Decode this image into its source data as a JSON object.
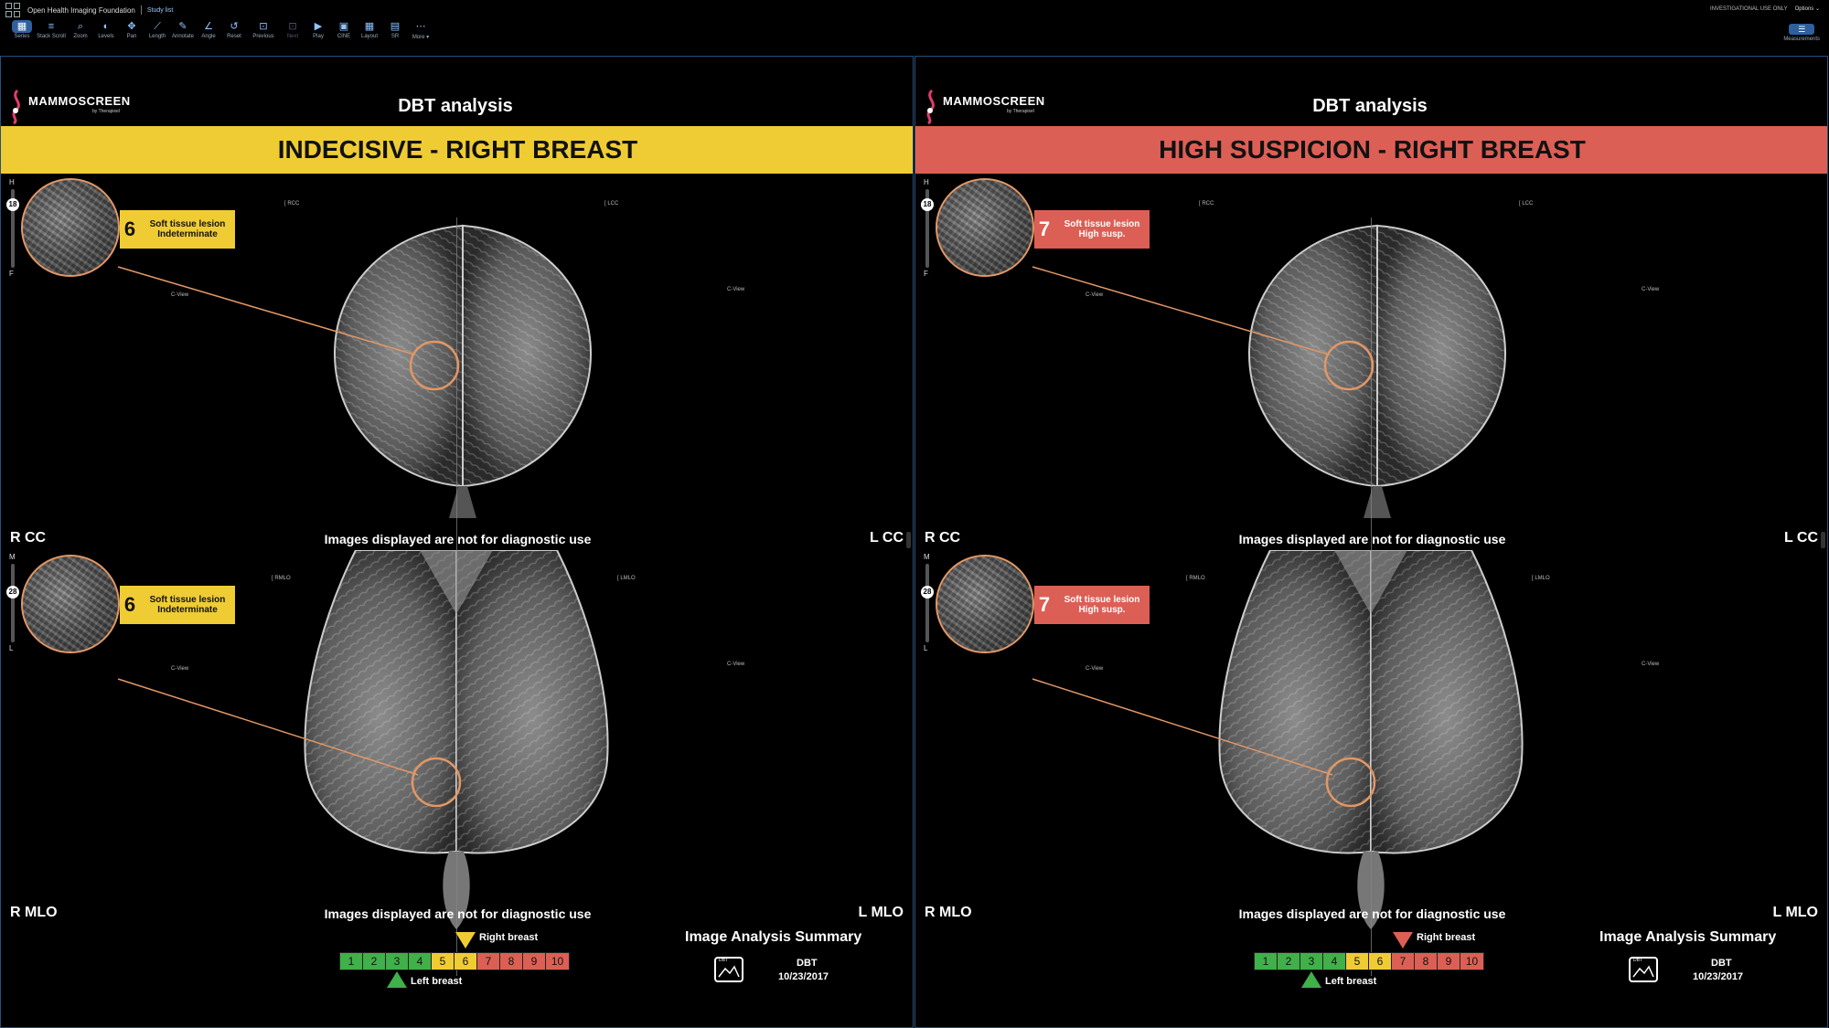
{
  "app": {
    "title": "Open Health Imaging Foundation",
    "study_list": "Study list",
    "investigational": "INVESTIGATIONAL USE ONLY",
    "options": "Options ⌄"
  },
  "toolbar": {
    "items": [
      {
        "label": "Series",
        "icon": "series-icon"
      },
      {
        "label": "Stack Scroll",
        "icon": "stack-scroll-icon"
      },
      {
        "label": "Zoom",
        "icon": "zoom-icon"
      },
      {
        "label": "Levels",
        "icon": "levels-icon"
      },
      {
        "label": "Pan",
        "icon": "pan-icon"
      },
      {
        "label": "Length",
        "icon": "length-icon"
      },
      {
        "label": "Annotate",
        "icon": "annotate-icon"
      },
      {
        "label": "Angle",
        "icon": "angle-icon"
      },
      {
        "label": "Reset",
        "icon": "reset-icon"
      },
      {
        "label": "Previous",
        "icon": "previous-icon"
      },
      {
        "label": "Next",
        "icon": "next-icon"
      },
      {
        "label": "Play",
        "icon": "play-icon"
      },
      {
        "label": "CINE",
        "icon": "cine-icon"
      },
      {
        "label": "Layout",
        "icon": "layout-icon"
      },
      {
        "label": "SR",
        "icon": "sr-icon"
      },
      {
        "label": "More ▾",
        "icon": "more-icon"
      }
    ],
    "measurements": "Measurements"
  },
  "panels": [
    {
      "logo": "MAMMOSCREEN",
      "logo_sub": "by Therapixel",
      "title": "DBT analysis",
      "banner": "INDECISIVE - RIGHT BREAST",
      "banner_color": "#efcc34",
      "lesion_score": "6",
      "lesion_line1": "Soft tissue lesion",
      "lesion_line2": "Indeterminate",
      "box_color": "#efcc34",
      "cc_slider": {
        "top": "H",
        "bottom": "F",
        "value": "18"
      },
      "mlo_slider": {
        "top": "M",
        "bottom": "L",
        "value": "28"
      },
      "labels": {
        "rcc": "R CC",
        "lcc": "L CC",
        "rmlo": "R MLO",
        "lmlo": "L MLO"
      },
      "tiny": {
        "rcc": "[ RCC",
        "lcc": "[ LCC",
        "rmlo": "[ RMLO",
        "lmlo": "[ LMLO",
        "view": "C-View"
      },
      "disclaimer": "Images displayed are not for diagnostic use",
      "right_breast": "Right breast",
      "left_breast": "Left breast",
      "right_score": 6,
      "left_score": 3,
      "right_marker_color": "#efcc34",
      "summary_title": "Image Analysis Summary",
      "summary_icon": "DBT",
      "summary_type": "DBT",
      "summary_date": "10/23/2017"
    },
    {
      "logo": "MAMMOSCREEN",
      "logo_sub": "by Therapixel",
      "title": "DBT analysis",
      "banner": "HIGH SUSPICION - RIGHT BREAST",
      "banner_color": "#dc5f55",
      "lesion_score": "7",
      "lesion_line1": "Soft tissue lesion",
      "lesion_line2": "High susp.",
      "box_color": "#dc5f55",
      "cc_slider": {
        "top": "H",
        "bottom": "F",
        "value": "18"
      },
      "mlo_slider": {
        "top": "M",
        "bottom": "L",
        "value": "28"
      },
      "labels": {
        "rcc": "R CC",
        "lcc": "L CC",
        "rmlo": "R MLO",
        "lmlo": "L MLO"
      },
      "tiny": {
        "rcc": "[ RCC",
        "lcc": "[ LCC",
        "rmlo": "[ RMLO",
        "lmlo": "[ LMLO",
        "view": "C-View"
      },
      "disclaimer": "Images displayed are not for diagnostic use",
      "right_breast": "Right breast",
      "left_breast": "Left breast",
      "right_score": 7,
      "left_score": 3,
      "right_marker_color": "#dc5f55",
      "summary_title": "Image Analysis Summary",
      "summary_icon": "DBT",
      "summary_type": "DBT",
      "summary_date": "10/23/2017"
    }
  ],
  "scale": {
    "values": [
      "1",
      "2",
      "3",
      "4",
      "5",
      "6",
      "7",
      "8",
      "9",
      "10"
    ],
    "colors": [
      "#3fb04a",
      "#3fb04a",
      "#3fb04a",
      "#3fb04a",
      "#efcc34",
      "#efcc34",
      "#dc5f55",
      "#dc5f55",
      "#dc5f55",
      "#dc5f55"
    ],
    "left_marker_color": "#3fb04a"
  }
}
